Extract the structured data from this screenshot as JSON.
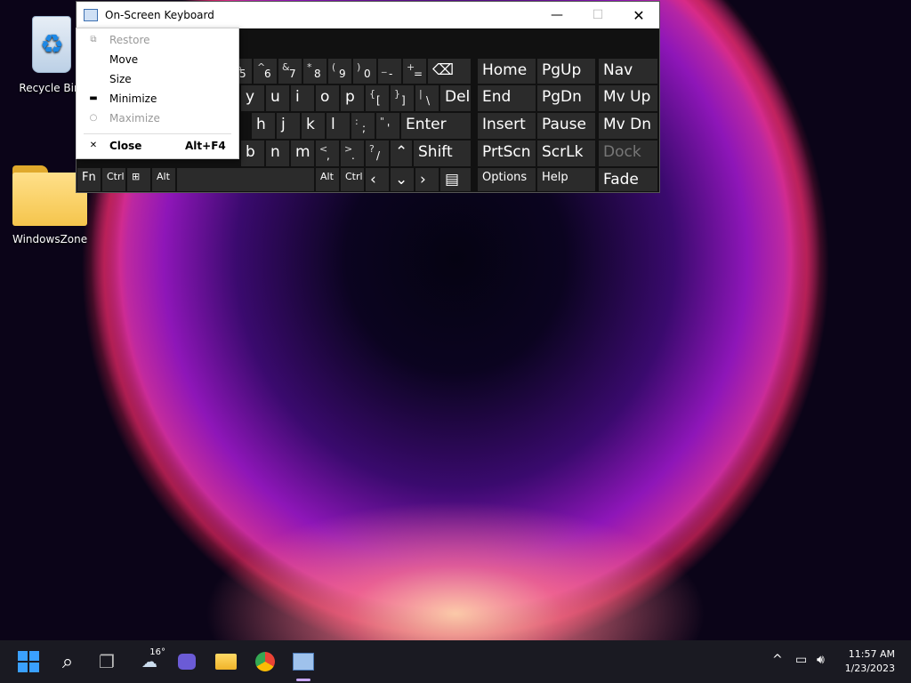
{
  "desktop": {
    "icons": [
      {
        "label": "Recycle Bin",
        "icon": "recycle-bin-icon"
      },
      {
        "label": "WindowsZone",
        "icon": "folder-icon"
      }
    ]
  },
  "osk": {
    "title": "On-Screen Keyboard",
    "rows": {
      "num": [
        {
          "sh": "%",
          "mn": "5"
        },
        {
          "sh": "^",
          "mn": "6"
        },
        {
          "sh": "&",
          "mn": "7"
        },
        {
          "sh": "*",
          "mn": "8"
        },
        {
          "sh": "(",
          "mn": "9"
        },
        {
          "sh": ")",
          "mn": "0"
        },
        {
          "sh": "_",
          "mn": "-"
        },
        {
          "sh": "+",
          "mn": "="
        }
      ],
      "top": [
        "y",
        "u",
        "i",
        "o",
        "p"
      ],
      "top_sym": [
        {
          "sh": "{",
          "mn": "["
        },
        {
          "sh": "}",
          "mn": "]"
        },
        {
          "sh": "|",
          "mn": "\\"
        }
      ],
      "del": "Del",
      "home_row": [
        "h",
        "j",
        "k",
        "l"
      ],
      "home_sym": [
        {
          "sh": ":",
          "mn": ";"
        },
        {
          "sh": "\"",
          "mn": "'"
        }
      ],
      "enter": "Enter",
      "bottom": [
        "b",
        "n",
        "m"
      ],
      "bottom_sym": [
        {
          "sh": "<",
          "mn": ","
        },
        {
          "sh": ">",
          "mn": "."
        },
        {
          "sh": "?",
          "mn": "/"
        }
      ],
      "shift": "Shift",
      "fn": "Fn",
      "ctrl": "Ctrl",
      "alt": "Alt",
      "alt_r": "Alt",
      "ctrl_r": "Ctrl"
    },
    "nav": {
      "home": "Home",
      "pgup": "PgUp",
      "nav": "Nav",
      "end": "End",
      "pgdn": "PgDn",
      "mvup": "Mv Up",
      "insert": "Insert",
      "pause": "Pause",
      "mvdn": "Mv Dn",
      "prtscn": "PrtScn",
      "scrlk": "ScrLk",
      "dock": "Dock",
      "options": "Options",
      "help": "Help",
      "fade": "Fade"
    }
  },
  "context_menu": {
    "items": [
      {
        "label": "Restore",
        "icon": "restore-icon",
        "disabled": true
      },
      {
        "label": "Move"
      },
      {
        "label": "Size"
      },
      {
        "label": "Minimize",
        "icon": "minimize-icon"
      },
      {
        "label": "Maximize",
        "icon": "maximize-icon",
        "disabled": true
      },
      {
        "label": "Close",
        "icon": "close-icon",
        "accel": "Alt+F4"
      }
    ]
  },
  "taskbar": {
    "weather_temp": "16°",
    "time": "11:57 AM",
    "date": "1/23/2023"
  }
}
